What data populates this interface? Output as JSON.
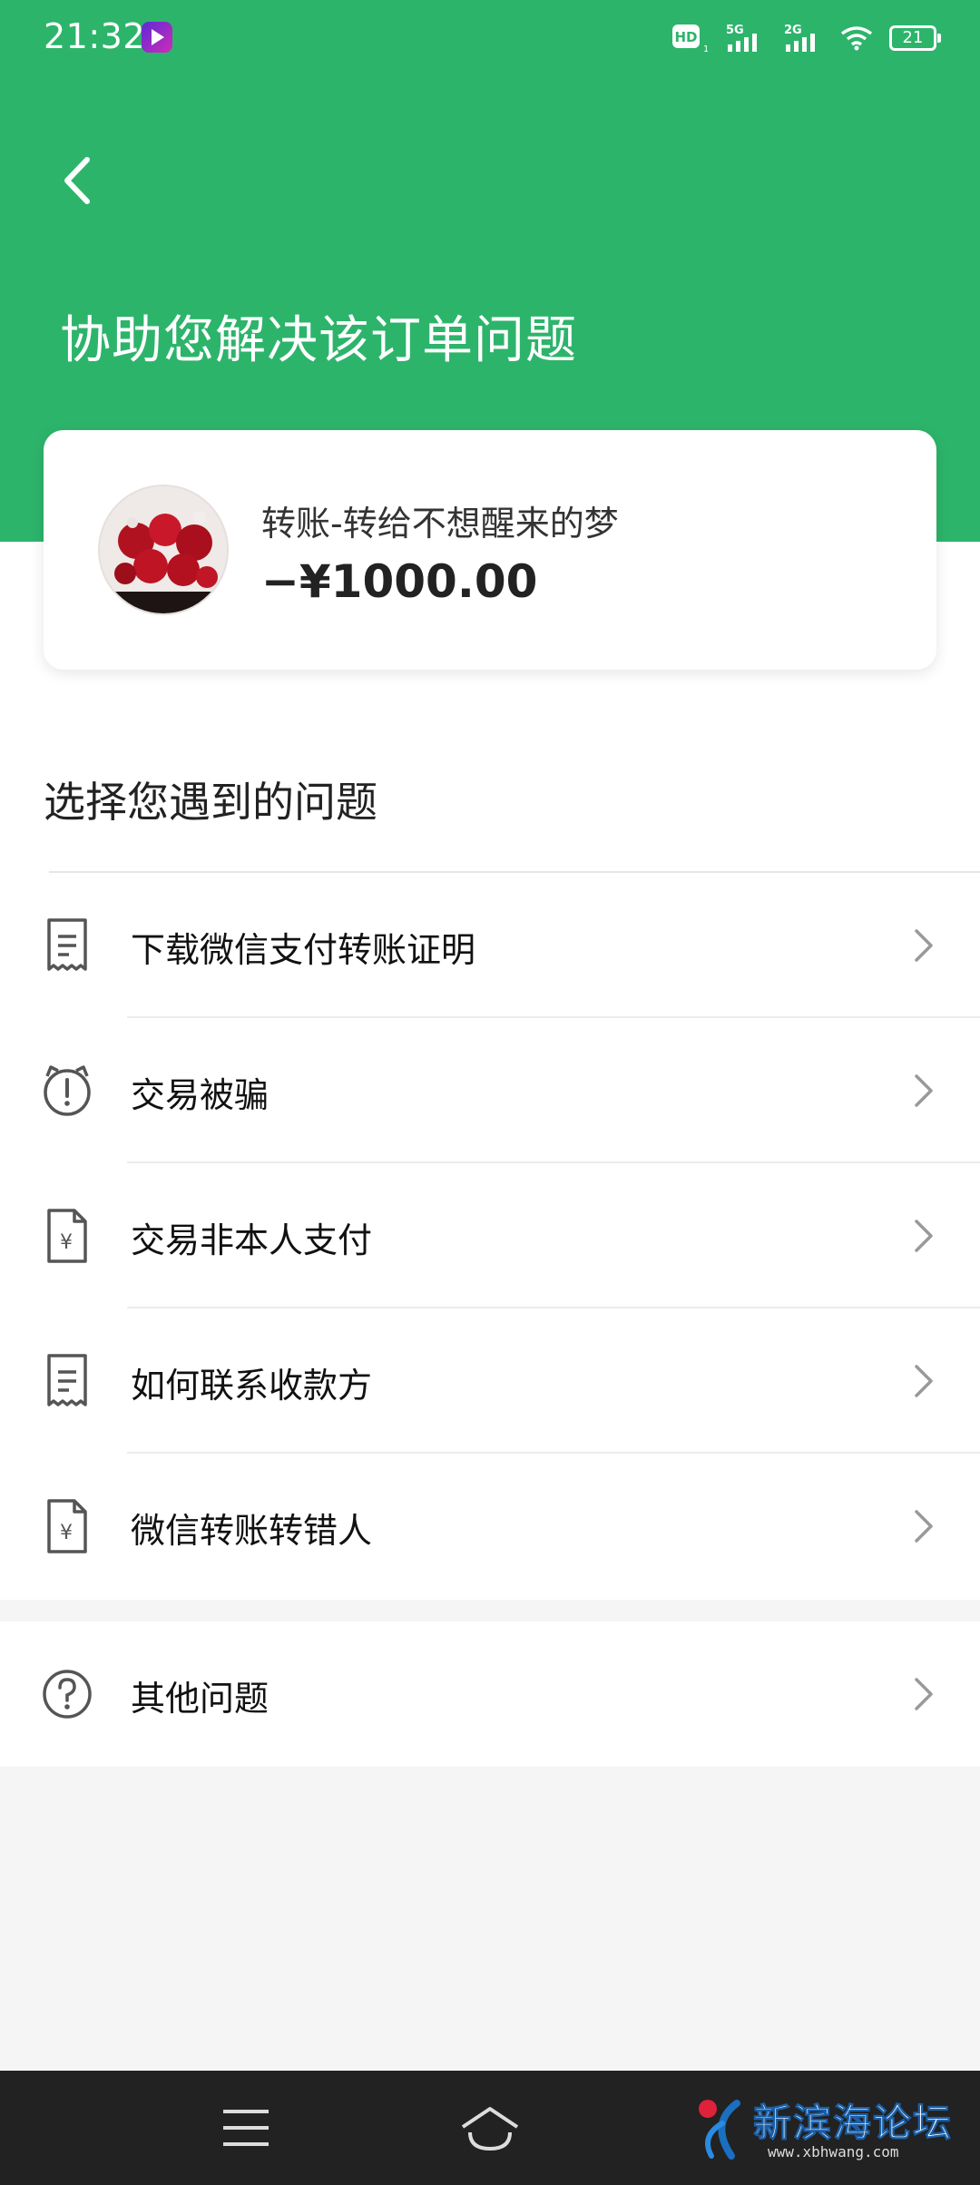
{
  "status_bar": {
    "time": "21:32",
    "network_hd": "HD",
    "network_5g": "5G",
    "network_2g": "2G",
    "battery": "21"
  },
  "header": {
    "title": "协助您解决该订单问题"
  },
  "order": {
    "title": "转账-转给不想醒来的梦",
    "amount": "−¥1000.00"
  },
  "section": {
    "label": "选择您遇到的问题"
  },
  "issues": [
    {
      "label": "下载微信支付转账证明",
      "icon": "receipt-icon"
    },
    {
      "label": "交易被骗",
      "icon": "alarm-alert-icon"
    },
    {
      "label": "交易非本人支付",
      "icon": "yen-document-icon"
    },
    {
      "label": "如何联系收款方",
      "icon": "receipt-icon"
    },
    {
      "label": "微信转账转错人",
      "icon": "yen-document-icon"
    }
  ],
  "other": {
    "label": "其他问题",
    "icon": "question-circle-icon"
  },
  "watermark": {
    "text": "新滨海论坛",
    "url": "www.xbhwang.com"
  },
  "colors": {
    "brand_green": "#2db46b",
    "nav_bg": "#222222"
  }
}
